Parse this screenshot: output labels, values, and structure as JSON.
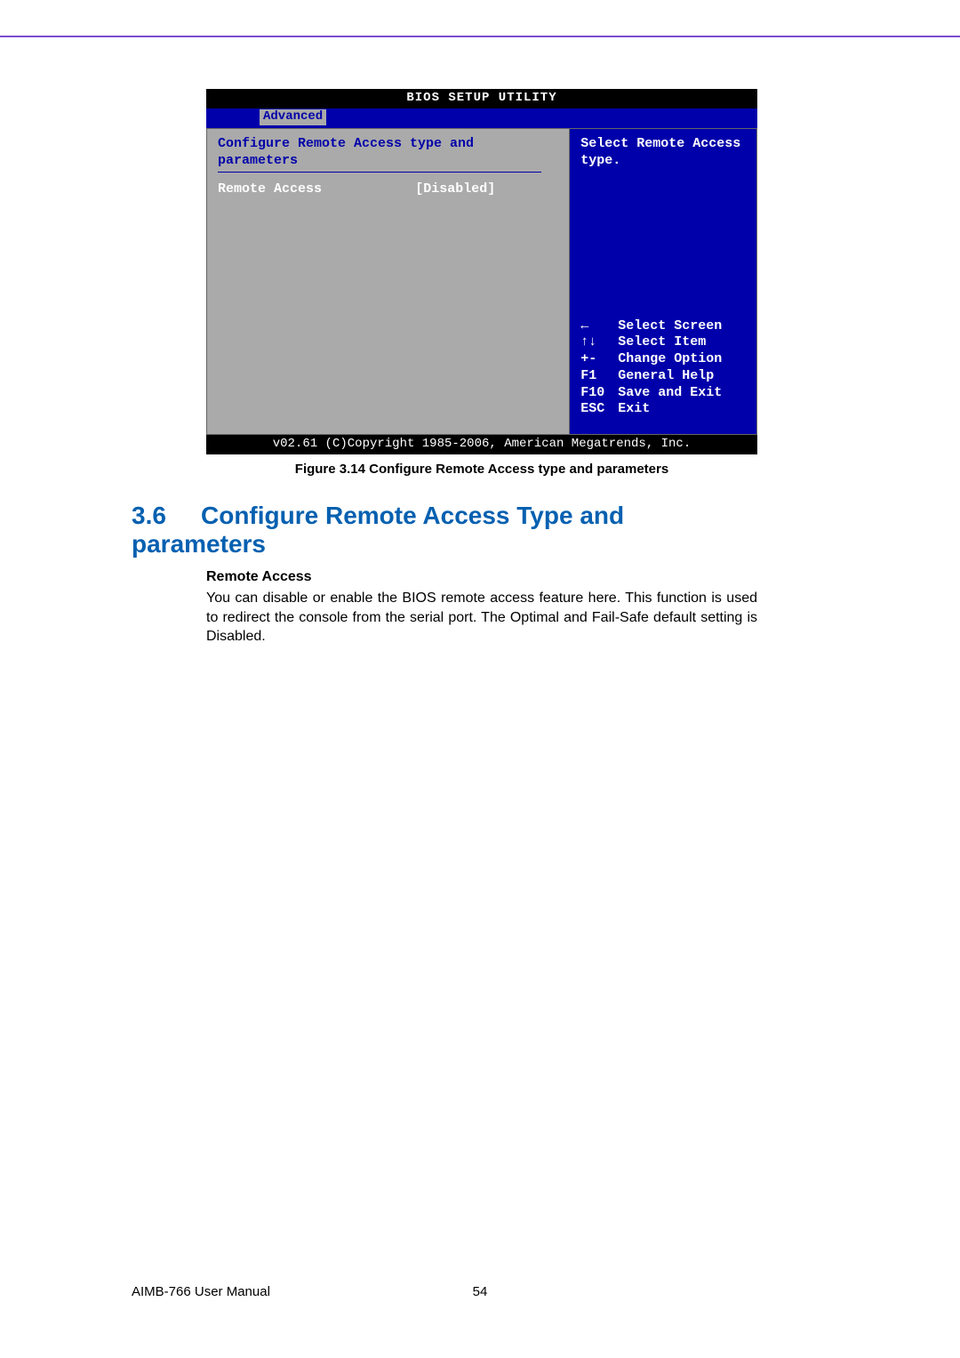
{
  "bios": {
    "title": "BIOS SETUP UTILITY",
    "tab": "Advanced",
    "subtitle": "Configure Remote Access type and parameters",
    "item_label": "Remote Access",
    "item_value": "[Disabled]",
    "help_text": "Select Remote Access type.",
    "keys": [
      {
        "k": "←",
        "t": "Select Screen"
      },
      {
        "k": "↑↓",
        "t": "Select Item"
      },
      {
        "k": "+-",
        "t": "Change Option"
      },
      {
        "k": "F1",
        "t": "General Help"
      },
      {
        "k": "F10",
        "t": "Save and Exit"
      },
      {
        "k": "ESC",
        "t": "Exit"
      }
    ],
    "footer": "v02.61 (C)Copyright 1985-2006, American Megatrends, Inc."
  },
  "figure_caption": "Figure 3.14 Configure Remote Access type and parameters",
  "section": {
    "number": "3.6",
    "title": "Configure Remote  Access Type and parameters",
    "sub_heading": "Remote Access",
    "body": "You can disable or enable the BIOS remote access feature here. This function is used to redirect the console from the serial port. The Optimal and Fail-Safe default setting is Disabled."
  },
  "footer": {
    "left": "AIMB-766 User Manual",
    "center": "54"
  }
}
